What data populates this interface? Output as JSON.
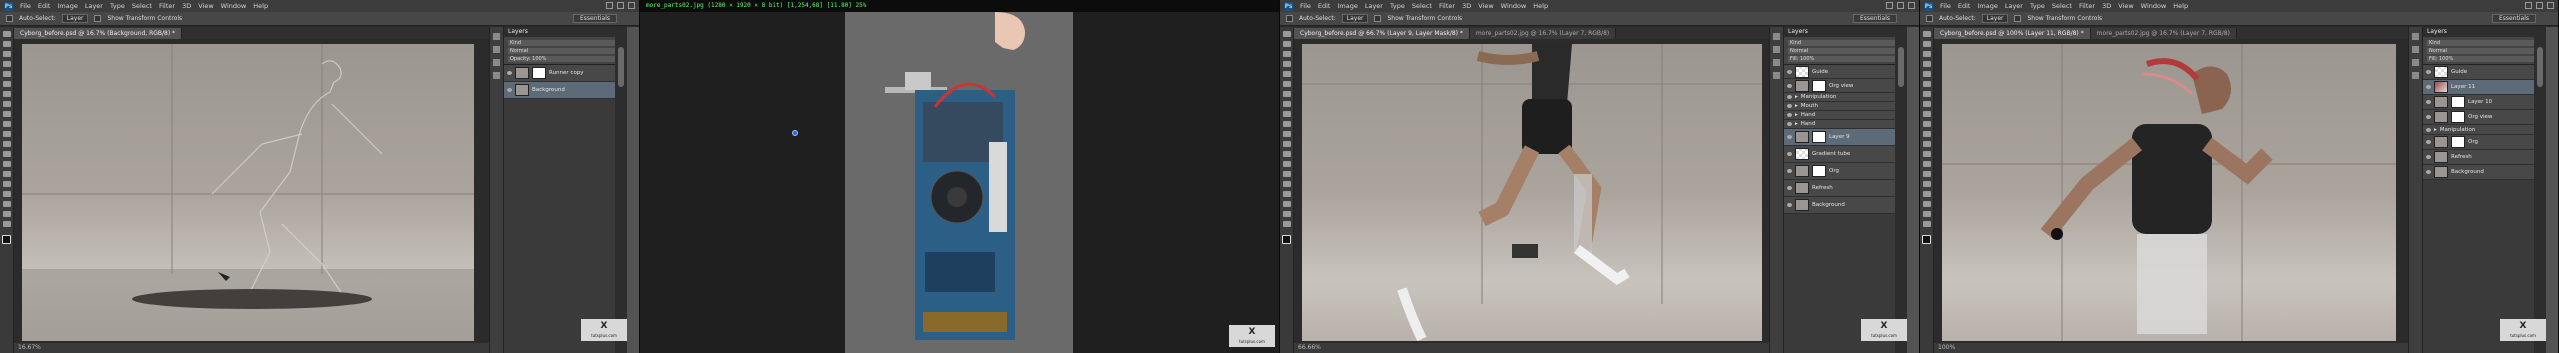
{
  "photoshop": {
    "menu": [
      "File",
      "Edit",
      "Image",
      "Layer",
      "Type",
      "Select",
      "Filter",
      "3D",
      "View",
      "Window",
      "Help"
    ],
    "workspace": "Essentials",
    "options": [
      "Auto-Select:",
      "Layer",
      "Show Transform Controls"
    ],
    "tab1": "Cyborg_before.psd @ 16.7% (Background, RGB/8) *",
    "tab3a": "Cyborg_before.psd @ 66.7% (Layer 9, Layer Mask/8) *",
    "tab3b": "more_parts02.jpg @ 16.7% (Layer 7, RGB/8)",
    "tab4a": "Cyborg_before.psd @ 100% (Layer 11, RGB/8) *",
    "tab4b": "more_parts02.jpg @ 16.7% (Layer 7, RGB/8)",
    "status1": "16.67%",
    "status3": "66.66%",
    "status4": "100%",
    "layers_title": "Layers",
    "kind": "Kind",
    "mode": "Normal",
    "opacity": "Opacity: 100%",
    "fill": "Fill: 100%",
    "layers1": [
      "Runner copy",
      "Background"
    ],
    "layers3": [
      "Guide",
      "Org view",
      "Manipulation",
      "Mouth",
      "Hand",
      "Hand",
      "Layer 9",
      "Gradient tube",
      "Org",
      "Refresh",
      "Background"
    ],
    "layers4": [
      "Guide",
      "Layer 11",
      "Layer 10",
      "Org view",
      "Manipulation",
      "Org",
      "Refresh",
      "Background"
    ]
  },
  "video": {
    "title": "more_parts02.jpg (1280 × 1920 × 8 bit) [1,254,68] [11.80] 25%"
  },
  "watermark": {
    "mark": "X",
    "text": "tutsplus.com"
  }
}
